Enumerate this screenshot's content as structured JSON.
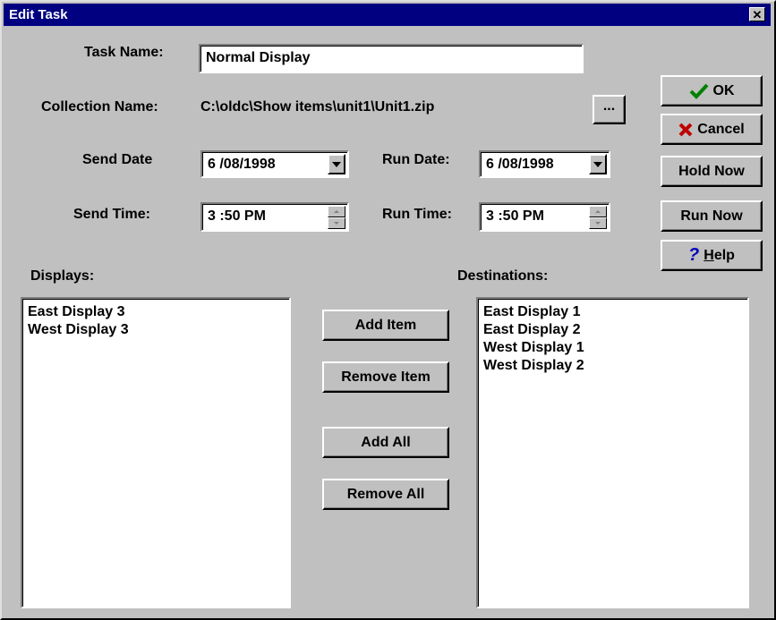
{
  "window": {
    "title": "Edit Task",
    "close_glyph": "✕"
  },
  "task_name": {
    "label": "Task Name:",
    "value": "Normal  Display"
  },
  "collection": {
    "label": "Collection Name:",
    "value": "C:\\oldc\\Show items\\unit1\\Unit1.zip",
    "browse_label": "..."
  },
  "send_date": {
    "label": "Send Date",
    "value": "6 /08/1998"
  },
  "run_date": {
    "label": "Run Date:",
    "value": "6 /08/1998"
  },
  "send_time": {
    "label": "Send Time:",
    "value": "3 :50 PM"
  },
  "run_time": {
    "label": "Run Time:",
    "value": "3 :50 PM"
  },
  "buttons": {
    "ok": "OK",
    "cancel": "Cancel",
    "hold_now": "Hold Now",
    "run_now": "Run Now",
    "help_pre": "",
    "help_u": "H",
    "help_post": "elp"
  },
  "icons": {
    "ok": "check-icon",
    "cancel": "x-icon",
    "help": "question-icon"
  },
  "colors": {
    "ok_check": "#008000",
    "cancel_x": "#c00000",
    "help_q": "#0000c0",
    "titlebar": "#000080"
  },
  "displays": {
    "label": "Displays:",
    "items": [
      "East Display 3",
      "West Display 3"
    ]
  },
  "destinations": {
    "label": "Destinations:",
    "items": [
      "East Display 1",
      "East Display 2",
      "West Display 1",
      "West Display 2"
    ]
  },
  "transfer": {
    "add_item": "Add Item",
    "remove_item": "Remove Item",
    "add_all": "Add All",
    "remove_all": "Remove All"
  }
}
